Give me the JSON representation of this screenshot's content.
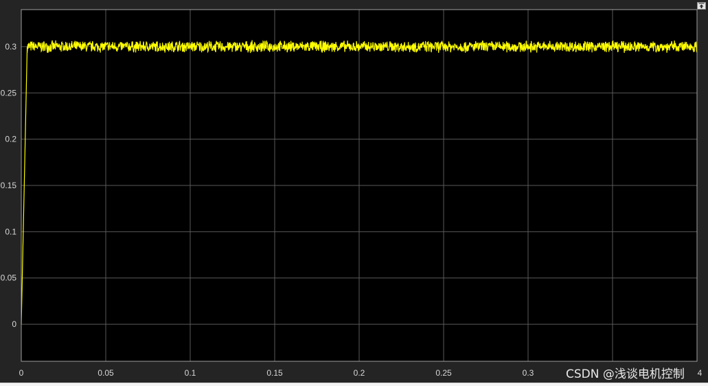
{
  "watermark": "CSDN @浅谈电机控制",
  "colors": {
    "background": "#242424",
    "axes_background": "#000000",
    "grid": "#5a5a5a",
    "axes_border": "#a0a0a0",
    "tick_text": "#d8d8d8",
    "line": "#ffff00"
  },
  "icons": {
    "restore": "restore-axes-icon"
  },
  "chart_data": {
    "type": "line",
    "title": "",
    "xlabel": "",
    "ylabel": "",
    "xlim": [
      0,
      0.4
    ],
    "ylim": [
      -0.04,
      0.34
    ],
    "x_ticks": [
      0,
      0.05,
      0.1,
      0.15,
      0.2,
      0.25,
      0.3,
      0.35,
      0.4
    ],
    "x_tick_labels": [
      "0",
      "0.05",
      "0.1",
      "0.15",
      "0.2",
      "0.25",
      "0.3",
      "",
      "4"
    ],
    "y_ticks": [
      0,
      0.05,
      0.1,
      0.15,
      0.2,
      0.25,
      0.3
    ],
    "y_tick_labels": [
      "0",
      "0.05",
      "0.1",
      "0.15",
      "0.2",
      "0.25",
      "0.3"
    ],
    "grid": true,
    "series": [
      {
        "color": "#ffff00",
        "rise": {
          "x": [
            0,
            0.0035
          ],
          "y": [
            0,
            0.3
          ]
        },
        "steady_state": {
          "x_start": 0.0035,
          "x_end": 0.4,
          "mean": 0.3,
          "ripple_min": 0.292,
          "ripple_max": 0.306
        }
      }
    ]
  }
}
